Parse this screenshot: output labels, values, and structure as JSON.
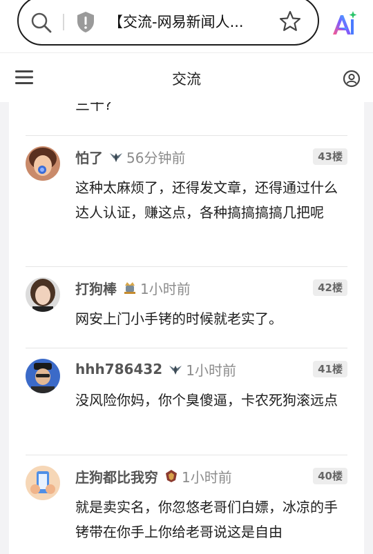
{
  "browser": {
    "url_text": "【交流-网易新闻人..."
  },
  "header": {
    "title": "交流"
  },
  "cut_off_text": "三十?",
  "comments": [
    {
      "user": "怕了",
      "time": "56分钟前",
      "floor": "43楼",
      "text": "这种太麻烦了，还得发文章，还得通过什么达人认证，赚这点，各种搞搞搞搞几把呢",
      "badge": "wings-badge-icon",
      "avatar": "avatar-lollipop"
    },
    {
      "user": "打狗棒",
      "time": "1小时前",
      "floor": "42楼",
      "text": "网安上门小手铐的时候就老实了。",
      "badge": "knight-badge-icon",
      "avatar": "avatar-woman"
    },
    {
      "user": "hhh786432",
      "time": "1小时前",
      "floor": "41楼",
      "text": "没风险你妈，你个臭傻逼，卡农死狗滚远点",
      "badge": "wings-badge-icon",
      "avatar": "avatar-man-glasses"
    },
    {
      "user": "庄狗都比我穷",
      "time": "1小时前",
      "floor": "40楼",
      "text": "就是卖实名，你忽悠老哥们白嫖，冰凉的手铐带在你手上你给老哥说这是自由",
      "badge": "crest-badge-icon",
      "avatar": "avatar-phone-cartoon"
    }
  ],
  "colors": {
    "accent_ai": "#7b5cff",
    "divider": "#e5e5e5",
    "floor_badge_bg": "#ededed"
  }
}
